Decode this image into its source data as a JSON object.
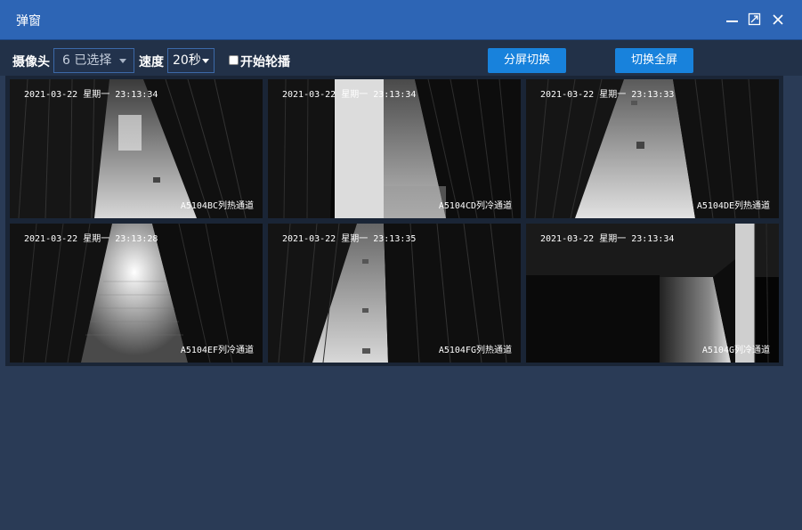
{
  "window": {
    "title": "弹窗",
    "minimize_icon": "minimize-icon",
    "maximize_icon": "maximize-icon",
    "close_icon": "close-icon"
  },
  "toolbar": {
    "camera_label": "摄像头",
    "camera_select_value": "6 已选择",
    "speed_label": "速度",
    "speed_select_value": "20秒",
    "rotate_checkbox_label": "开始轮播",
    "split_button": "分屏切换",
    "fullscreen_button": "切换全屏"
  },
  "cameras": [
    {
      "timestamp": "2021-03-22 星期一 23:13:34",
      "name": "A5104BC列热通道"
    },
    {
      "timestamp": "2021-03-22 星期一 23:13:34",
      "name": "A5104CD列冷通道"
    },
    {
      "timestamp": "2021-03-22 星期一 23:13:33",
      "name": "A5104DE列热通道"
    },
    {
      "timestamp": "2021-03-22 星期一 23:13:28",
      "name": "A5104EF列冷通道"
    },
    {
      "timestamp": "2021-03-22 星期一 23:13:35",
      "name": "A5104FG列热通道"
    },
    {
      "timestamp": "2021-03-22 星期一 23:13:34",
      "name": "A5104G列冷通道"
    }
  ],
  "colors": {
    "titlebar": "#2d65b5",
    "background": "#2a3b56",
    "button": "#1882dc"
  }
}
